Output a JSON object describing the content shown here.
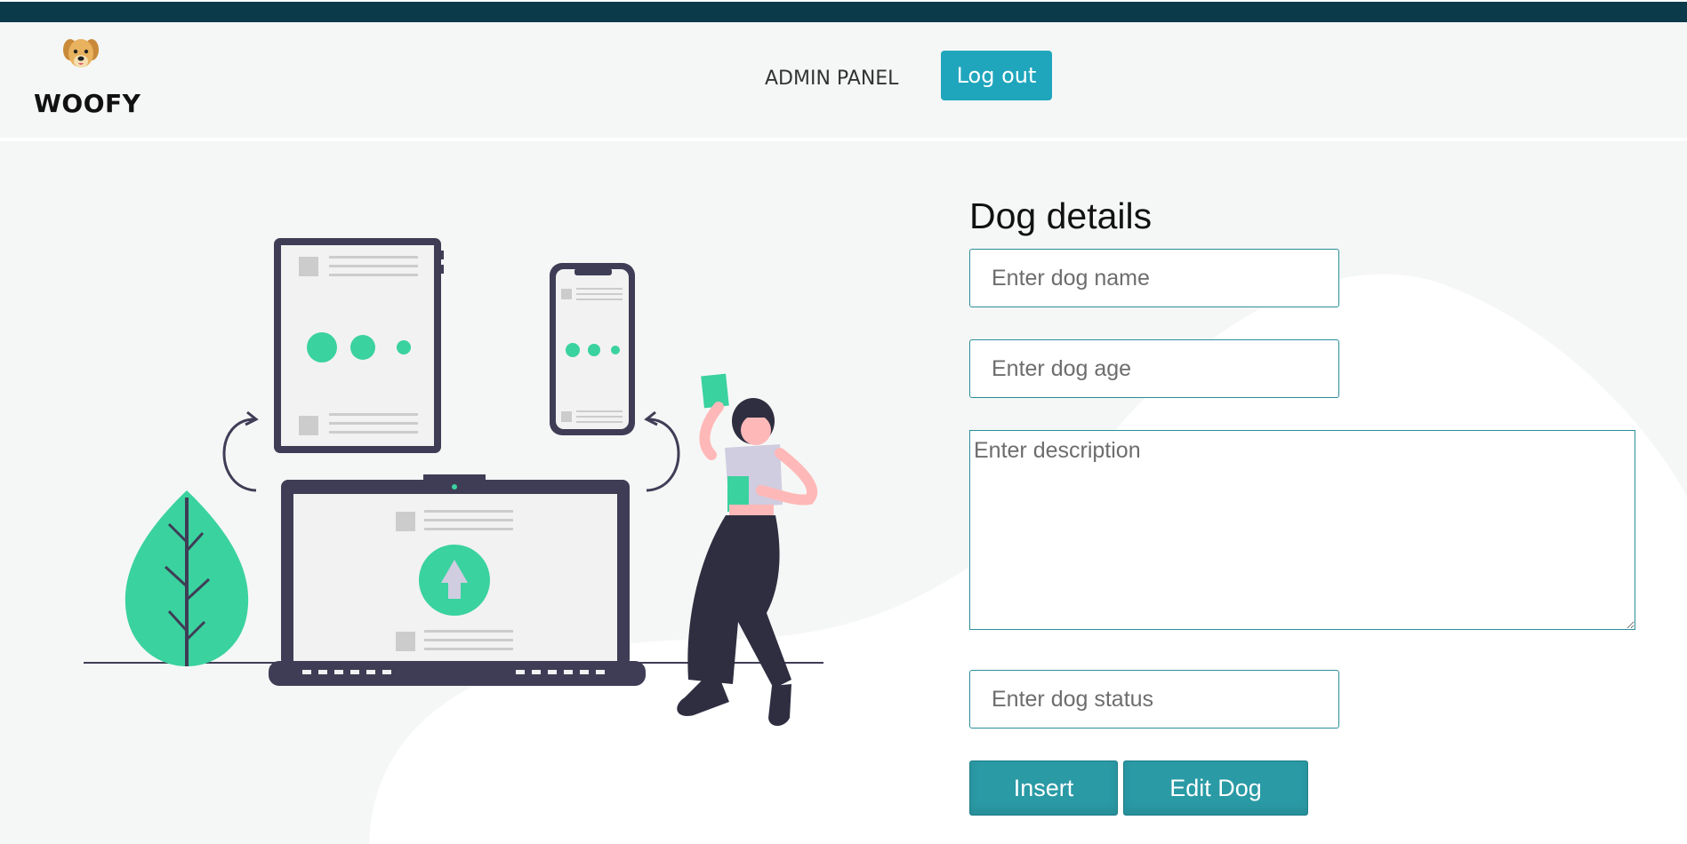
{
  "header": {
    "brand": "WOOFY",
    "nav_admin": "ADMIN PANEL",
    "logout_label": "Log out"
  },
  "form": {
    "title": "Dog details",
    "name_placeholder": "Enter dog name",
    "age_placeholder": "Enter dog age",
    "description_placeholder": "Enter description",
    "status_placeholder": "Enter dog status",
    "insert_label": "Insert",
    "edit_label": "Edit Dog"
  },
  "colors": {
    "topbar": "#0b3a4a",
    "accent": "#1fa6bd",
    "button": "#2a9aa5",
    "illustration_green": "#3ad29f",
    "illustration_dark": "#3f3d56"
  },
  "icons": {
    "logo": "dog-face-icon"
  }
}
